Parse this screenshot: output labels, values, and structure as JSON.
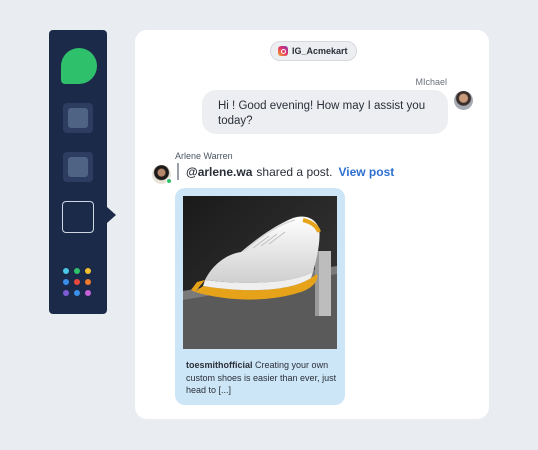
{
  "sidebar": {
    "logo_color": "#2fc06b",
    "items": [
      {
        "name": "sidebar-item-1"
      },
      {
        "name": "sidebar-item-2"
      },
      {
        "name": "sidebar-item-3",
        "active": true
      }
    ],
    "app_dots": [
      "#4cc9e6",
      "#2fc06b",
      "#f5c02f",
      "#3b8fe8",
      "#e8493b",
      "#f07a2b",
      "#7b5cd6",
      "#3b8fe8",
      "#c561d9"
    ]
  },
  "chat": {
    "channel_label": "IG_Acmekart",
    "agent": {
      "name": "MIchael",
      "message": "Hi ! Good evening! How may I assist you today?"
    },
    "customer": {
      "name": "Arlene Warren",
      "handle": "@arlene.wa",
      "share_text": "shared a post.",
      "view_post_label": "View post"
    },
    "post": {
      "author": "toesmithofficial",
      "caption": "Creating your own custom shoes is easier than ever, just head to [...]"
    }
  },
  "colors": {
    "sidebar_bg": "#1c2a4a",
    "link": "#2f6fd0",
    "post_card_bg": "#cde6f7"
  }
}
